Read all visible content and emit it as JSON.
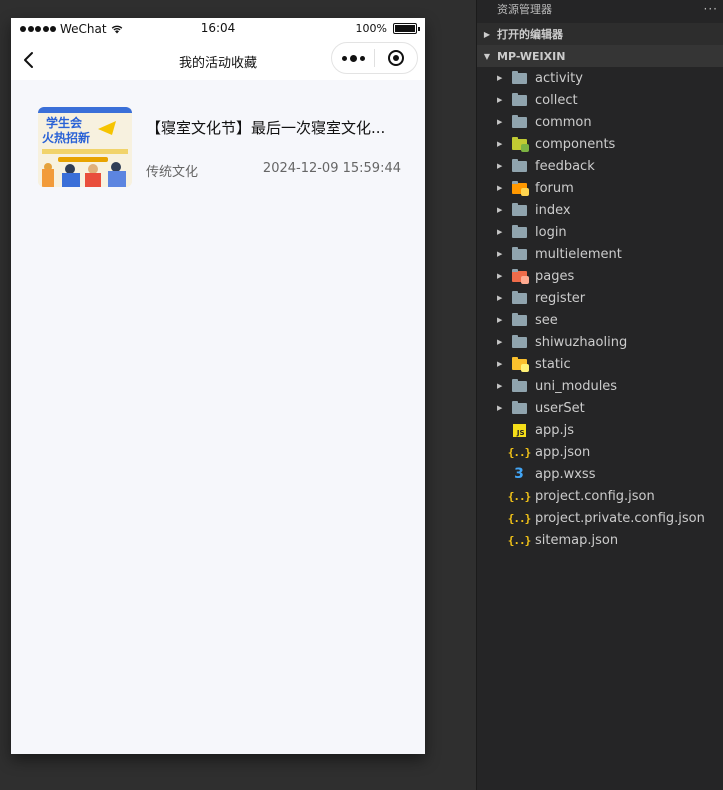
{
  "status_bar": {
    "carrier": "WeChat",
    "time": "16:04",
    "battery": "100%"
  },
  "navbar": {
    "title": "我的活动收藏"
  },
  "favorites": [
    {
      "title": "【寝室文化节】最后一次寝室文化...",
      "category": "传统文化",
      "date": "2024-12-09 15:59:44",
      "thumb_text_line1": "学生会",
      "thumb_text_line2": "火热招新"
    }
  ],
  "explorer": {
    "header": "资源管理器",
    "open_editors": "打开的编辑器",
    "project": "MP-WEIXIN",
    "folders": [
      {
        "name": "activity",
        "color": "grey"
      },
      {
        "name": "collect",
        "color": "grey"
      },
      {
        "name": "common",
        "color": "grey"
      },
      {
        "name": "components",
        "color": "lime"
      },
      {
        "name": "feedback",
        "color": "grey"
      },
      {
        "name": "forum",
        "color": "orange"
      },
      {
        "name": "index",
        "color": "grey"
      },
      {
        "name": "login",
        "color": "grey"
      },
      {
        "name": "multielement",
        "color": "grey"
      },
      {
        "name": "pages",
        "color": "red"
      },
      {
        "name": "register",
        "color": "grey"
      },
      {
        "name": "see",
        "color": "grey"
      },
      {
        "name": "shiwuzhaoling",
        "color": "grey"
      },
      {
        "name": "static",
        "color": "yellow"
      },
      {
        "name": "uni_modules",
        "color": "grey"
      },
      {
        "name": "userSet",
        "color": "grey"
      }
    ],
    "files": [
      {
        "name": "app.js",
        "icon": "js-icon"
      },
      {
        "name": "app.json",
        "icon": "json-icon"
      },
      {
        "name": "app.wxss",
        "icon": "css-icon"
      },
      {
        "name": "project.config.json",
        "icon": "json-icon"
      },
      {
        "name": "project.private.config.json",
        "icon": "json-icon"
      },
      {
        "name": "sitemap.json",
        "icon": "json-icon"
      }
    ]
  }
}
